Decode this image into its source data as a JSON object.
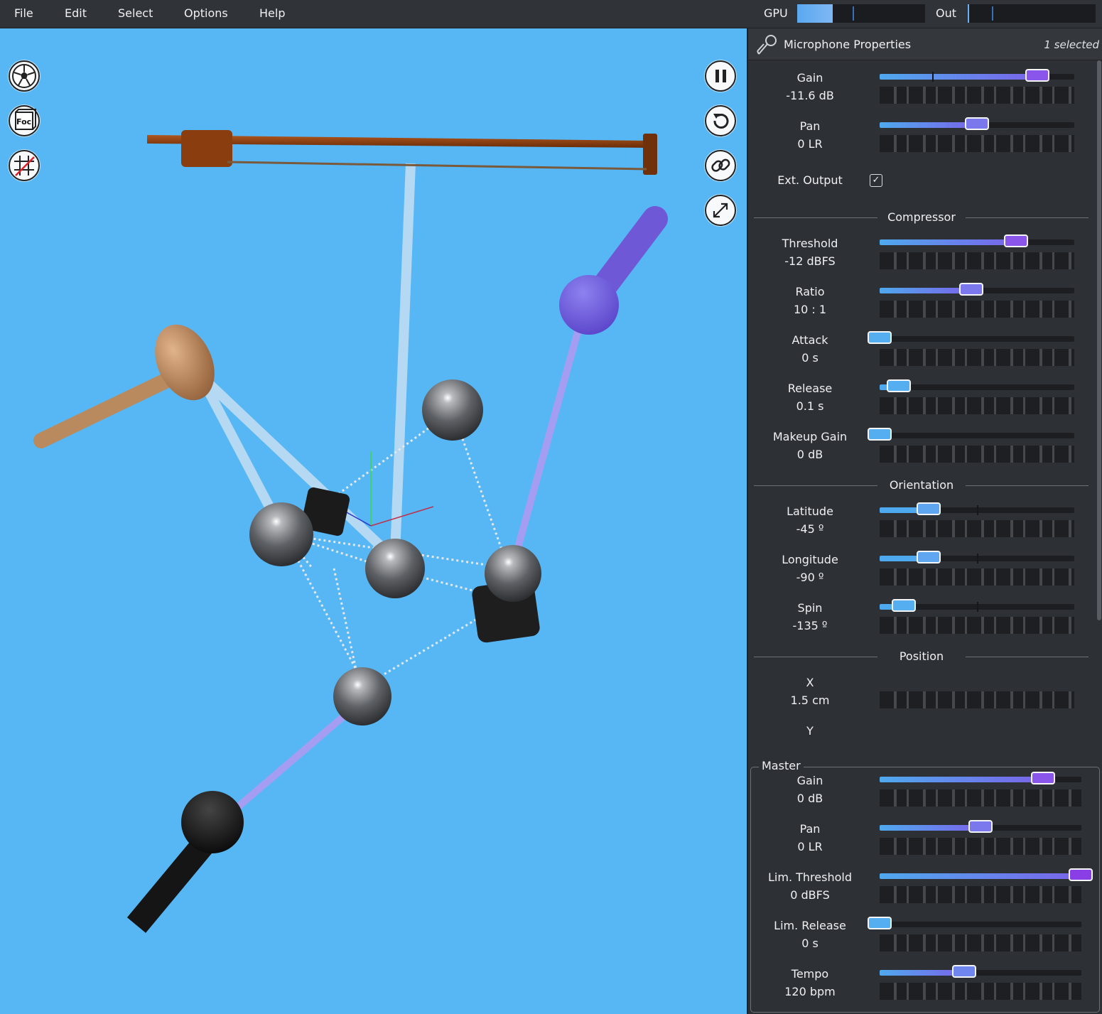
{
  "menu": {
    "items": [
      "File",
      "Edit",
      "Select",
      "Options",
      "Help"
    ],
    "gpu_label": "GPU",
    "out_label": "Out",
    "gpu_level": 0.28,
    "out_level": 0.01
  },
  "viewport": {
    "background": "#57b7f4",
    "left_tools": [
      "football-icon",
      "focus-icon",
      "grid-toggle-icon"
    ],
    "focus_text": "Foc",
    "right_tools": [
      "pause-icon",
      "rotate-icon",
      "link-icon",
      "fullscreen-icon"
    ]
  },
  "panel": {
    "title": "Microphone Properties",
    "selected": "1 selected",
    "properties": [
      {
        "label": "Gain",
        "value": "-11.6 dB",
        "level": 0.81,
        "center": 0.27,
        "accent": "#8a55ea"
      },
      {
        "label": "Pan",
        "value": "0 LR",
        "level": 0.5,
        "center": 0.5,
        "accent": "#7b78ee"
      },
      {
        "label": "Ext. Output",
        "checked": true
      },
      {
        "section": "Compressor"
      },
      {
        "label": "Threshold",
        "value": "-12 dBFS",
        "level": 0.7,
        "accent": "#8a55ea"
      },
      {
        "label": "Ratio",
        "value": "10 : 1",
        "level": 0.47,
        "accent": "#7b78ee"
      },
      {
        "label": "Attack",
        "value": "0 s",
        "level": 0.0,
        "accent": "#55aef0"
      },
      {
        "label": "Release",
        "value": "0.1 s",
        "level": 0.1,
        "accent": "#55aef0"
      },
      {
        "label": "Makeup Gain",
        "value": "0 dB",
        "level": 0.0,
        "accent": "#55aef0"
      },
      {
        "section": "Orientation"
      },
      {
        "label": "Latitude",
        "value": "-45 º",
        "level": 0.25,
        "center": 0.5,
        "accent": "#5fa6f0"
      },
      {
        "label": "Longitude",
        "value": "-90 º",
        "level": 0.25,
        "center": 0.5,
        "accent": "#5fa6f0"
      },
      {
        "label": "Spin",
        "value": "-135 º",
        "level": 0.125,
        "center": 0.5,
        "accent": "#55aef0"
      },
      {
        "section": "Position"
      },
      {
        "label": "X",
        "value": "1.5 cm",
        "nobar": true
      },
      {
        "label": "Y"
      }
    ],
    "master": {
      "title": "Master",
      "properties": [
        {
          "label": "Gain",
          "value": "0 dB",
          "level": 0.81,
          "accent": "#8a55ea"
        },
        {
          "label": "Pan",
          "value": "0 LR",
          "level": 0.5,
          "accent": "#7b78ee"
        },
        {
          "label": "Lim. Threshold",
          "value": "0 dBFS",
          "level": 1.0,
          "accent": "#8a3fe6"
        },
        {
          "label": "Lim. Release",
          "value": "0 s",
          "level": 0.0,
          "accent": "#55aef0"
        },
        {
          "label": "Tempo",
          "value": "120 bpm",
          "level": 0.42,
          "accent": "#6f86ef"
        }
      ]
    }
  }
}
